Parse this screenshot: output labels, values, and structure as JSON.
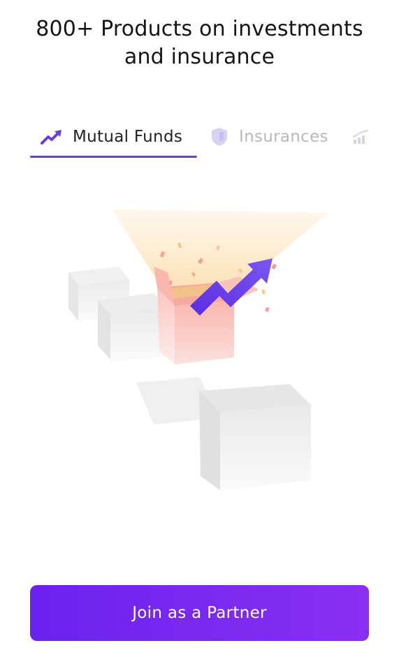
{
  "headline": {
    "line1": "800+ Products on investments",
    "line2": "and insurance"
  },
  "tabs": [
    {
      "label": "Mutual Funds",
      "icon": "trending-up-icon",
      "active": true
    },
    {
      "label": "Insurances",
      "icon": "shield-icon",
      "active": false
    },
    {
      "label": "",
      "icon": "bar-chart-icon",
      "active": false
    }
  ],
  "colors": {
    "accent": "#6a3fd6",
    "button_start": "#6a22f0",
    "button_end": "#8a2ff2"
  },
  "cta": {
    "label": "Join as a Partner"
  }
}
